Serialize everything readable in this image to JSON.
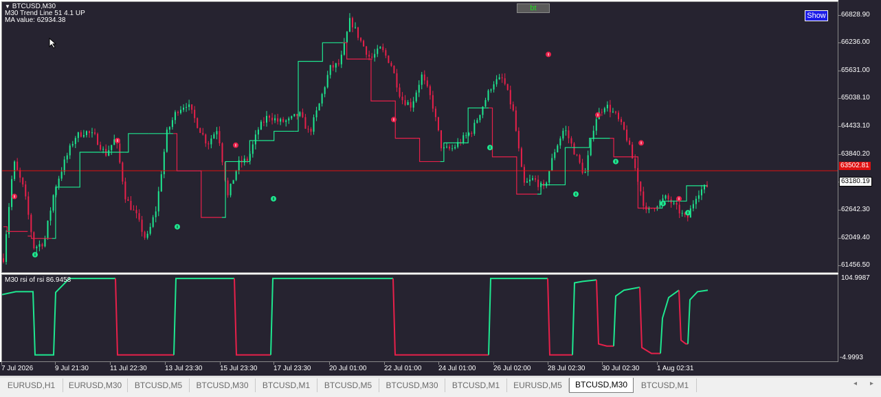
{
  "colors": {
    "background": "#262330",
    "bull": "#1ee890",
    "bear": "#e8204a",
    "text": "#ffffff",
    "price_line": "#e01010"
  },
  "header": {
    "symbol": "BTCUSD,M30",
    "indicator_line": "M30 Trend Line 51 4.1 UP",
    "ma_value": "MA value: 62934.38"
  },
  "toolbar": {
    "bt_label": "bt",
    "show_label": "Show"
  },
  "price_axis": {
    "labels": [
      "66828.90",
      "66236.00",
      "65631.00",
      "65038.10",
      "64433.10",
      "63840.20",
      "63247.30",
      "62642.30",
      "62049.40",
      "61456.50"
    ],
    "current_price_badge": "63502.81",
    "ma_badge": "63180.19"
  },
  "subwindow": {
    "title": "M30 rsi of rsi",
    "value": "86.9458",
    "axis_top": "104.9987",
    "axis_bottom": "-4.9993"
  },
  "time_axis": {
    "labels": [
      "7 Jul 2026",
      "9 Jul 21:30",
      "11 Jul 22:30",
      "13 Jul 23:30",
      "15 Jul 23:30",
      "17 Jul 23:30",
      "20 Jul 01:00",
      "22 Jul 01:00",
      "24 Jul 01:00",
      "26 Jul 02:00",
      "28 Jul 02:30",
      "30 Jul 02:30",
      "1 Aug 02:31"
    ]
  },
  "tabs": [
    {
      "label": "EURUSD,H1",
      "active": false
    },
    {
      "label": "EURUSD,M30",
      "active": false
    },
    {
      "label": "BTCUSD,M5",
      "active": false
    },
    {
      "label": "BTCUSD,M30",
      "active": false
    },
    {
      "label": "BTCUSD,M1",
      "active": false
    },
    {
      "label": "BTCUSD,M5",
      "active": false
    },
    {
      "label": "BTCUSD,M30",
      "active": false
    },
    {
      "label": "BTCUSD,M1",
      "active": false
    },
    {
      "label": "EURUSD,M5",
      "active": false
    },
    {
      "label": "BTCUSD,M30",
      "active": true
    },
    {
      "label": "BTCUSD,M1",
      "active": false
    }
  ],
  "scroll_icons": {
    "left": "◂",
    "right": "▸"
  },
  "chart_data": {
    "type": "candlestick",
    "symbol": "BTCUSD",
    "timeframe": "M30",
    "ylim": [
      61300,
      66900
    ],
    "current_price": 63502.81,
    "path_points": [
      [
        61450,
        61800
      ],
      [
        63600,
        63800
      ],
      [
        62900,
        63300
      ],
      [
        61700,
        62000
      ],
      [
        61850,
        62100
      ],
      [
        62900,
        63300
      ],
      [
        63500,
        63900
      ],
      [
        64100,
        64350
      ],
      [
        64300,
        64400
      ],
      [
        64150,
        64300
      ],
      [
        63700,
        64000
      ],
      [
        64100,
        64300
      ],
      [
        62700,
        63100
      ],
      [
        62400,
        62700
      ],
      [
        61900,
        62100
      ],
      [
        62500,
        62900
      ],
      [
        64100,
        64500
      ],
      [
        64700,
        64900
      ],
      [
        64850,
        65050
      ],
      [
        64400,
        64600
      ],
      [
        63900,
        64250
      ],
      [
        64300,
        64550
      ],
      [
        62800,
        63100
      ],
      [
        63500,
        63800
      ],
      [
        63600,
        63900
      ],
      [
        64300,
        64500
      ],
      [
        64600,
        64800
      ],
      [
        64400,
        64700
      ],
      [
        64500,
        64650
      ],
      [
        64650,
        64800
      ],
      [
        64200,
        64400
      ],
      [
        64800,
        65100
      ],
      [
        65600,
        65800
      ],
      [
        65700,
        65900
      ],
      [
        66700,
        66800
      ],
      [
        66200,
        66400
      ],
      [
        65800,
        66000
      ],
      [
        66050,
        66200
      ],
      [
        65700,
        65900
      ],
      [
        64900,
        65200
      ],
      [
        64800,
        65000
      ],
      [
        65500,
        65600
      ],
      [
        64900,
        65100
      ],
      [
        63800,
        64100
      ],
      [
        63900,
        64050
      ],
      [
        64100,
        64250
      ],
      [
        64300,
        64450
      ],
      [
        64800,
        65000
      ],
      [
        65300,
        65500
      ],
      [
        65400,
        65550
      ],
      [
        64600,
        64900
      ],
      [
        63100,
        63300
      ],
      [
        63200,
        63450
      ],
      [
        63000,
        63200
      ],
      [
        63800,
        64000
      ],
      [
        64350,
        64500
      ],
      [
        63800,
        64000
      ],
      [
        63300,
        63500
      ],
      [
        64500,
        64700
      ],
      [
        64850,
        65000
      ],
      [
        64600,
        64800
      ],
      [
        64200,
        64400
      ],
      [
        63400,
        63600
      ],
      [
        62500,
        62700
      ],
      [
        62700,
        62850
      ],
      [
        62850,
        63000
      ],
      [
        62600,
        62800
      ],
      [
        62350,
        62550
      ],
      [
        62950,
        63100
      ],
      [
        63100,
        63250
      ]
    ],
    "ma_steps": [
      [
        62300,
        62200
      ],
      [
        62100,
        62050
      ],
      [
        62050,
        63150
      ],
      [
        63150,
        63900
      ],
      [
        63900,
        63900
      ],
      [
        63900,
        64300
      ],
      [
        64300,
        64300
      ],
      [
        64300,
        63500
      ],
      [
        63500,
        62500
      ],
      [
        62500,
        63700
      ],
      [
        63700,
        64150
      ],
      [
        64150,
        64350
      ],
      [
        64350,
        65850
      ],
      [
        65850,
        66250
      ],
      [
        66250,
        65900
      ],
      [
        65900,
        65000
      ],
      [
        65000,
        64200
      ],
      [
        64200,
        63700
      ],
      [
        63700,
        64100
      ],
      [
        64100,
        64850
      ],
      [
        64850,
        63800
      ],
      [
        63800,
        63000
      ],
      [
        63000,
        63200
      ],
      [
        63200,
        64000
      ],
      [
        64000,
        64200
      ],
      [
        64200,
        63800
      ],
      [
        63800,
        62700
      ],
      [
        62700,
        62850
      ],
      [
        62850,
        63180
      ]
    ],
    "signals": {
      "down": [
        [
          62950,
          "bear"
        ],
        [
          64150,
          "bear"
        ],
        [
          64050,
          "bear"
        ],
        [
          64600,
          "bear"
        ],
        [
          66000,
          "bear"
        ],
        [
          64700,
          "bear"
        ],
        [
          64100,
          "bear"
        ],
        [
          62900,
          "bear"
        ]
      ],
      "up": [
        [
          61700,
          "bull"
        ],
        [
          62300,
          "bull"
        ],
        [
          62900,
          "bull"
        ],
        [
          64000,
          "bull"
        ],
        [
          63000,
          "bull"
        ],
        [
          63700,
          "bull"
        ],
        [
          62800,
          "bull"
        ],
        [
          62600,
          "bull"
        ]
      ]
    },
    "rsi": {
      "ylim": [
        -4.9993,
        104.9987
      ],
      "segments": [
        [
          [
            0,
            82
          ],
          [
            20,
            86
          ],
          [
            45,
            86
          ],
          [
            48,
            0
          ],
          [
            75,
            0
          ],
          [
            78,
            85
          ],
          [
            98,
            104
          ],
          [
            165,
            104
          ]
        ],
        [
          [
            165,
            104
          ],
          [
            168,
            0
          ],
          [
            250,
            0
          ]
        ],
        [
          [
            250,
            0
          ],
          [
            253,
            104
          ],
          [
            338,
            104
          ]
        ],
        [
          [
            338,
            104
          ],
          [
            341,
            0
          ],
          [
            391,
            0
          ]
        ],
        [
          [
            391,
            0
          ],
          [
            394,
            104
          ],
          [
            569,
            104
          ]
        ],
        [
          [
            569,
            104
          ],
          [
            572,
            0
          ],
          [
            708,
            0
          ]
        ],
        [
          [
            708,
            0
          ],
          [
            711,
            104
          ],
          [
            794,
            104
          ]
        ],
        [
          [
            794,
            104
          ],
          [
            797,
            0
          ],
          [
            830,
            0
          ]
        ],
        [
          [
            830,
            0
          ],
          [
            833,
            98
          ],
          [
            845,
            100
          ],
          [
            865,
            102
          ]
        ],
        [
          [
            865,
            102
          ],
          [
            868,
            15
          ],
          [
            880,
            12
          ],
          [
            890,
            12
          ]
        ],
        [
          [
            890,
            12
          ],
          [
            893,
            80
          ],
          [
            905,
            88
          ],
          [
            928,
            92
          ]
        ],
        [
          [
            928,
            92
          ],
          [
            931,
            10
          ],
          [
            945,
            2
          ],
          [
            958,
            2
          ]
        ],
        [
          [
            958,
            2
          ],
          [
            961,
            50
          ],
          [
            970,
            78
          ],
          [
            985,
            88
          ]
        ],
        [
          [
            985,
            88
          ],
          [
            988,
            20
          ],
          [
            995,
            15
          ],
          [
            998,
            15
          ]
        ],
        [
          [
            998,
            15
          ],
          [
            1001,
            75
          ],
          [
            1012,
            86
          ],
          [
            1027,
            88
          ]
        ]
      ]
    }
  }
}
